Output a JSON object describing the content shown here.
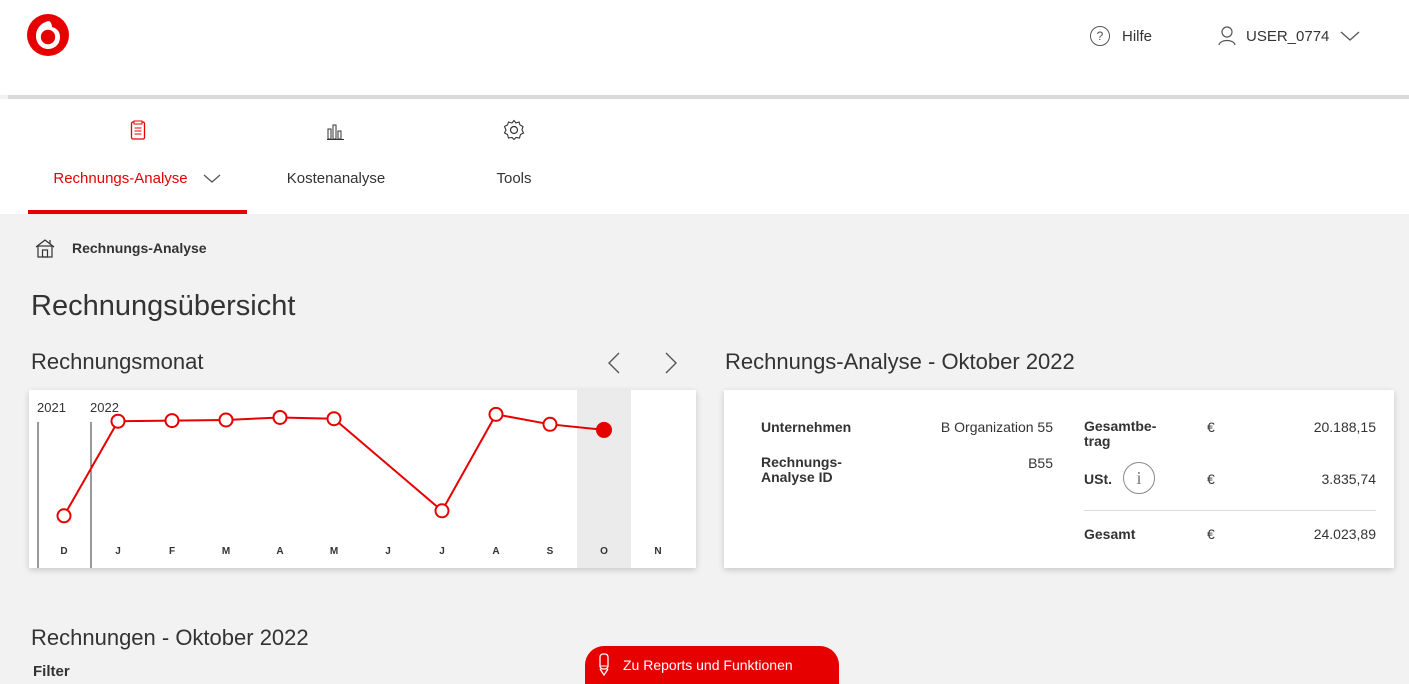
{
  "colors": {
    "brand": "#e60000",
    "text": "#333333",
    "bg": "#f2f2f2"
  },
  "header": {
    "logo_icon": "vodafone-logo",
    "help_label": "Hilfe",
    "user_label": "USER_0774"
  },
  "nav": {
    "items": [
      {
        "label": "Rechnungs-Analyse",
        "icon": "document-icon",
        "active": true
      },
      {
        "label": "Kostenanalyse",
        "icon": "bar-chart-icon",
        "active": false
      },
      {
        "label": "Tools",
        "icon": "gear-icon",
        "active": false
      }
    ]
  },
  "breadcrumb": {
    "current": "Rechnungs-Analyse"
  },
  "page_title": "Rechnungsübersicht",
  "month_chart": {
    "title": "Rechnungsmonat",
    "prev_label": "‹",
    "next_label": "›"
  },
  "chart_data": {
    "type": "line",
    "year_labels": [
      "2021",
      "2022"
    ],
    "x": [
      "D",
      "J",
      "F",
      "M",
      "A",
      "M",
      "J",
      "J",
      "A",
      "S",
      "O",
      "N"
    ],
    "values": [
      16000,
      31200,
      31300,
      31400,
      31800,
      31600,
      null,
      16800,
      32300,
      30700,
      29800,
      null
    ],
    "selected_index": 10,
    "color": "#e60000"
  },
  "analysis": {
    "title": "Rechnungs-Analyse - Oktober 2022",
    "company_label": "Unternehmen",
    "company_value": "B Organization 55",
    "id_label_1": "Rechnungs-",
    "id_label_2": "Analyse ID",
    "id_value": "B55",
    "total_label_1": "Gesamtbe-",
    "total_label_2": "trag",
    "total_currency": "€",
    "total_value": "20.188,15",
    "vat_label": "USt.",
    "vat_currency": "€",
    "vat_value": "3.835,74",
    "grand_label": "Gesamt",
    "grand_currency": "€",
    "grand_value": "24.023,89"
  },
  "invoices": {
    "title": "Rechnungen - Oktober 2022",
    "filter_label": "Filter"
  },
  "reports_button": {
    "label": "Zu Reports und Funktionen"
  }
}
